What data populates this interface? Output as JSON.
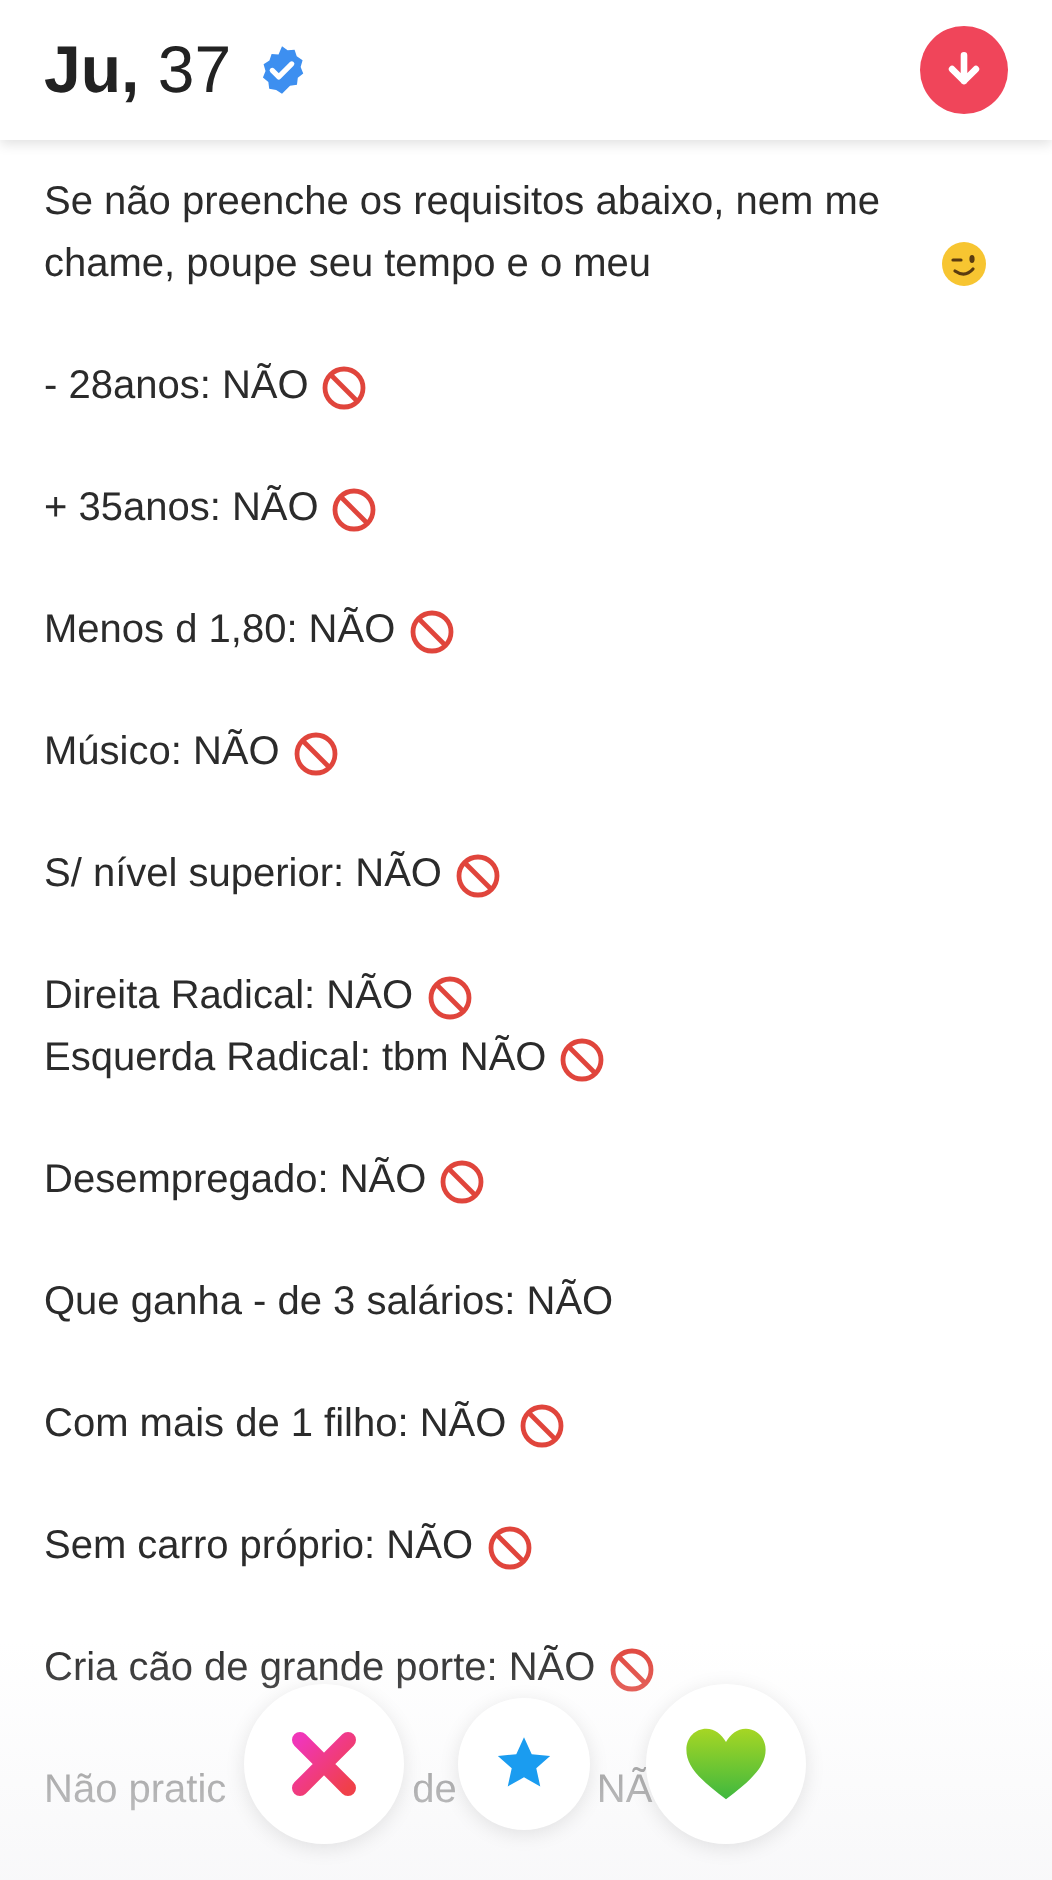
{
  "profile": {
    "name": "Ju,",
    "age": "37",
    "verified": true
  },
  "bio": {
    "intro": "Se não preenche os requisitos abaixo, nem me chame, poupe seu tempo e o meu",
    "groups": [
      {
        "lines": [
          {
            "text": "- 28anos: NÃO",
            "prohibited": true
          }
        ]
      },
      {
        "lines": [
          {
            "text": "+ 35anos: NÃO",
            "prohibited": true
          }
        ]
      },
      {
        "lines": [
          {
            "text": "Menos d 1,80: NÃO",
            "prohibited": true
          }
        ]
      },
      {
        "lines": [
          {
            "text": "Músico: NÃO",
            "prohibited": true
          }
        ]
      },
      {
        "lines": [
          {
            "text": "S/ nível superior: NÃO",
            "prohibited": true
          }
        ]
      },
      {
        "lines": [
          {
            "text": "Direita Radical: NÃO",
            "prohibited": true
          },
          {
            "text": "Esquerda Radical: tbm NÃO",
            "prohibited": true
          }
        ]
      },
      {
        "lines": [
          {
            "text": "Desempregado: NÃO",
            "prohibited": true
          }
        ]
      },
      {
        "lines": [
          {
            "text": "Que ganha - de 3 salários: NÃO",
            "prohibited": false
          }
        ]
      },
      {
        "lines": [
          {
            "text": "Com mais de 1 filho: NÃO",
            "prohibited": true
          }
        ]
      },
      {
        "lines": [
          {
            "text": "Sem carro próprio: NÃO",
            "prohibited": true
          }
        ]
      },
      {
        "lines": [
          {
            "text": "Cria cão de grande porte: NÃO",
            "prohibited": true
          }
        ]
      }
    ],
    "covered_line": [
      "Não pratic",
      "de",
      "NÃ"
    ]
  },
  "actions": [
    {
      "kind": "nope"
    },
    {
      "kind": "superlike"
    },
    {
      "kind": "like"
    }
  ]
}
